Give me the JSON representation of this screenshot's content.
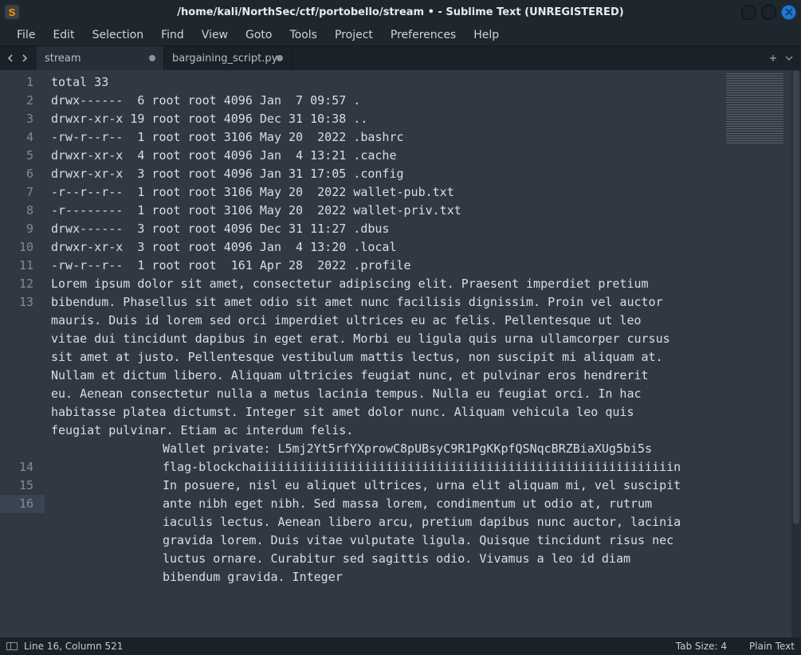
{
  "window": {
    "title": "/home/kali/NorthSec/ctf/portobello/stream • - Sublime Text (UNREGISTERED)"
  },
  "menu": {
    "items": [
      "File",
      "Edit",
      "Selection",
      "Find",
      "View",
      "Goto",
      "Tools",
      "Project",
      "Preferences",
      "Help"
    ]
  },
  "tabs": [
    {
      "label": "stream",
      "dirty": true,
      "active": true
    },
    {
      "label": "bargaining_script.py",
      "dirty": true,
      "active": false
    }
  ],
  "editor": {
    "lines": [
      {
        "n": 1,
        "text": "total 33"
      },
      {
        "n": 2,
        "text": "drwx------  6 root root 4096 Jan  7 09:57 ."
      },
      {
        "n": 3,
        "text": "drwxr-xr-x 19 root root 4096 Dec 31 10:38 .."
      },
      {
        "n": 4,
        "text": "-rw-r--r--  1 root root 3106 May 20  2022 .bashrc"
      },
      {
        "n": 5,
        "text": "drwxr-xr-x  4 root root 4096 Jan  4 13:21 .cache"
      },
      {
        "n": 6,
        "text": "drwxr-xr-x  3 root root 4096 Jan 31 17:05 .config"
      },
      {
        "n": 7,
        "text": "-r--r--r--  1 root root 3106 May 20  2022 wallet-pub.txt"
      },
      {
        "n": 8,
        "text": "-r--------  1 root root 3106 May 20  2022 wallet-priv.txt"
      },
      {
        "n": 9,
        "text": "drwx------  3 root root 4096 Dec 31 11:27 .dbus"
      },
      {
        "n": 10,
        "text": "drwxr-xr-x  3 root root 4096 Jan  4 13:20 .local"
      },
      {
        "n": 11,
        "text": "-rw-r--r--  1 root root  161 Apr 28  2022 .profile"
      },
      {
        "n": 12,
        "text": ""
      },
      {
        "n": 13,
        "text": "Lorem ipsum dolor sit amet, consectetur adipiscing elit. Praesent imperdiet pretium bibendum. Phasellus sit amet odio sit amet nunc facilisis dignissim. Proin vel auctor mauris. Duis id lorem sed orci imperdiet ultrices eu ac felis. Pellentesque ut leo vitae dui tincidunt dapibus in eget erat. Morbi eu ligula quis urna ullamcorper cursus sit amet at justo. Pellentesque vestibulum mattis lectus, non suscipit mi aliquam at. Nullam et dictum libero. Aliquam ultricies feugiat nunc, et pulvinar eros hendrerit eu. Aenean consectetur nulla a metus lacinia tempus. Nulla eu feugiat orci. In hac habitasse platea dictumst. Integer sit amet dolor nunc. Aliquam vehicula leo quis feugiat pulvinar. Etiam ac interdum felis."
      },
      {
        "n": 14,
        "text": "Wallet private: L5mj2Yt5rfYXprowC8pUBsyC9R1PgKKpfQSNqcBRZBiaXUg5bi5s",
        "indent": 14
      },
      {
        "n": 15,
        "text": "flag-blockchaiiiiiiiiiiiiiiiiiiiiiiiiiiiiiiiiiiiiiiiiiiiiiiiiiiiiiiiiiin",
        "indent": 14
      },
      {
        "n": 16,
        "text": "In posuere, nisl eu aliquet ultrices, urna elit aliquam mi, vel suscipit ante nibh eget nibh. Sed massa lorem, condimentum ut odio at, rutrum iaculis lectus. Aenean libero arcu, pretium dapibus nunc auctor, lacinia gravida lorem. Duis vitae vulputate ligula. Quisque tincidunt risus nec luctus ornare. Curabitur sed sagittis odio. Vivamus a leo id diam bibendum gravida. Integer",
        "indent": 14,
        "current": true
      }
    ]
  },
  "status": {
    "cursor": "Line 16, Column 521",
    "indent": "Tab Size: 4",
    "syntax": "Plain Text"
  }
}
